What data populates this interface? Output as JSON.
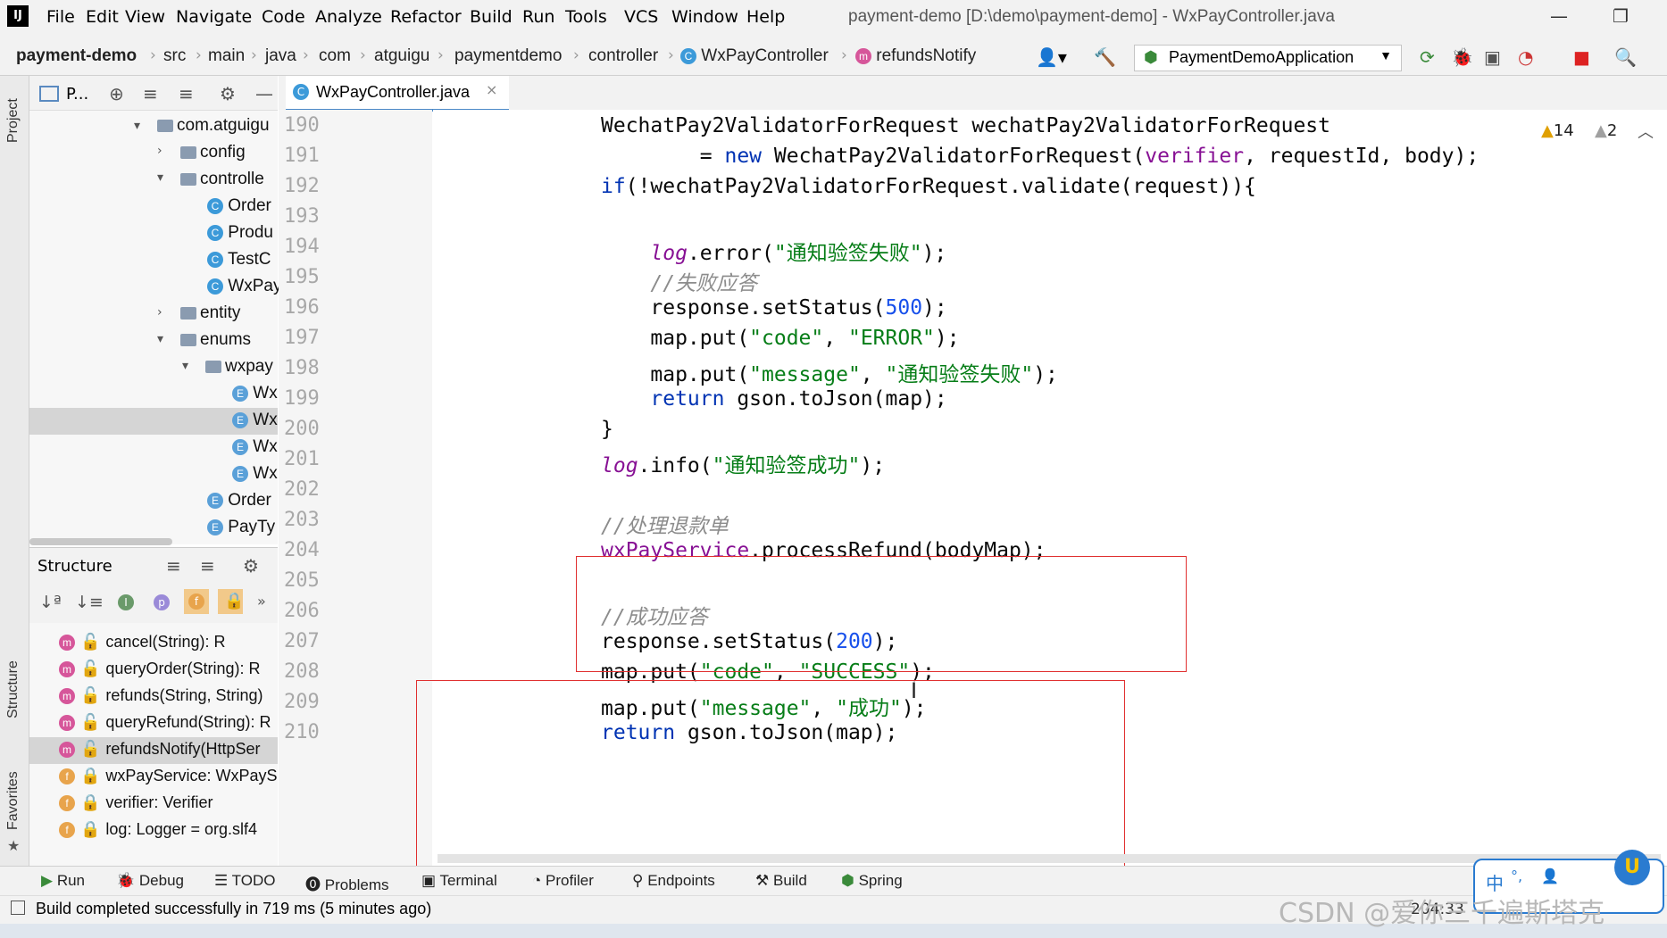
{
  "menu": {
    "items": [
      "File",
      "Edit",
      "View",
      "Navigate",
      "Code",
      "Analyze",
      "Refactor",
      "Build",
      "Run",
      "Tools",
      "VCS",
      "Window",
      "Help"
    ],
    "window_title": "payment-demo [D:\\demo\\payment-demo] - WxPayController.java"
  },
  "nav": {
    "project": "payment-demo",
    "crumbs": [
      "src",
      "main",
      "java",
      "com",
      "atguigu",
      "paymentdemo",
      "controller"
    ],
    "class_name": "WxPayController",
    "method_name": "refundsNotify",
    "run_config": "PaymentDemoApplication"
  },
  "project_panel": {
    "header": "P...",
    "tree": [
      {
        "label": "com.atguigu",
        "kind": "folder",
        "open": true
      },
      {
        "label": "config",
        "kind": "folder",
        "open": false
      },
      {
        "label": "controlle",
        "kind": "folder",
        "open": true
      },
      {
        "label": "Order",
        "kind": "class"
      },
      {
        "label": "Produ",
        "kind": "class"
      },
      {
        "label": "TestC",
        "kind": "class"
      },
      {
        "label": "WxPay",
        "kind": "class"
      },
      {
        "label": "entity",
        "kind": "folder",
        "open": false
      },
      {
        "label": "enums",
        "kind": "folder",
        "open": true
      },
      {
        "label": "wxpay",
        "kind": "folder",
        "open": true
      },
      {
        "label": "Wx",
        "kind": "enum"
      },
      {
        "label": "Wx",
        "kind": "enum",
        "selected": true
      },
      {
        "label": "Wx",
        "kind": "enum"
      },
      {
        "label": "Wx",
        "kind": "enum"
      },
      {
        "label": "Order",
        "kind": "enum"
      },
      {
        "label": "PayTy",
        "kind": "enum"
      }
    ]
  },
  "structure": {
    "title": "Structure",
    "items": [
      {
        "icon": "m",
        "label": "cancel(String): R"
      },
      {
        "icon": "m",
        "label": "queryOrder(String): R"
      },
      {
        "icon": "m",
        "label": "refunds(String, String)"
      },
      {
        "icon": "m",
        "label": "queryRefund(String): R"
      },
      {
        "icon": "m",
        "label": "refundsNotify(HttpSer",
        "selected": true
      },
      {
        "icon": "f",
        "label": "wxPayService: WxPayS"
      },
      {
        "icon": "f",
        "label": "verifier: Verifier"
      },
      {
        "icon": "f",
        "label": "log: Logger = org.slf4"
      }
    ]
  },
  "editor": {
    "tab": "WxPayController.java",
    "warnings": "14",
    "weak_warnings": "2",
    "line_numbers": [
      "190",
      "191",
      "192",
      "193",
      "194",
      "195",
      "196",
      "197",
      "198",
      "199",
      "200",
      "201",
      "202",
      "203",
      "204",
      "205",
      "206",
      "207",
      "208",
      "209",
      "210"
    ],
    "lines": [
      "WechatPay2ValidatorForRequest wechatPay2ValidatorForRequest",
      "        = new WechatPay2ValidatorForRequest(verifier, requestId, body);",
      "if(!wechatPay2ValidatorForRequest.validate(request)){",
      "",
      "    log.error(\"通知验签失败\");",
      "    //失败应答",
      "    response.setStatus(500);",
      "    map.put(\"code\", \"ERROR\");",
      "    map.put(\"message\", \"通知验签失败\");",
      "    return gson.toJson(map);",
      "}",
      "log.info(\"通知验签成功\");",
      "",
      "//处理退款单",
      "wxPayService.processRefund(bodyMap);",
      "",
      "//成功应答",
      "response.setStatus(200);",
      "map.put(\"code\", \"SUCCESS\");",
      "map.put(\"message\", \"成功\");",
      "return gson.toJson(map);"
    ]
  },
  "bottom_tools": [
    "Run",
    "Debug",
    "TODO",
    "Problems",
    "Terminal",
    "Profiler",
    "Endpoints",
    "Build",
    "Spring"
  ],
  "left_strip": [
    "Project",
    "Structure",
    "Favorites"
  ],
  "status": {
    "message": "Build completed successfully in 719 ms (5 minutes ago)",
    "position": "204:33"
  },
  "watermark": "CSDN @爱你三千遍斯塔克",
  "ime": {
    "lang": "中"
  }
}
